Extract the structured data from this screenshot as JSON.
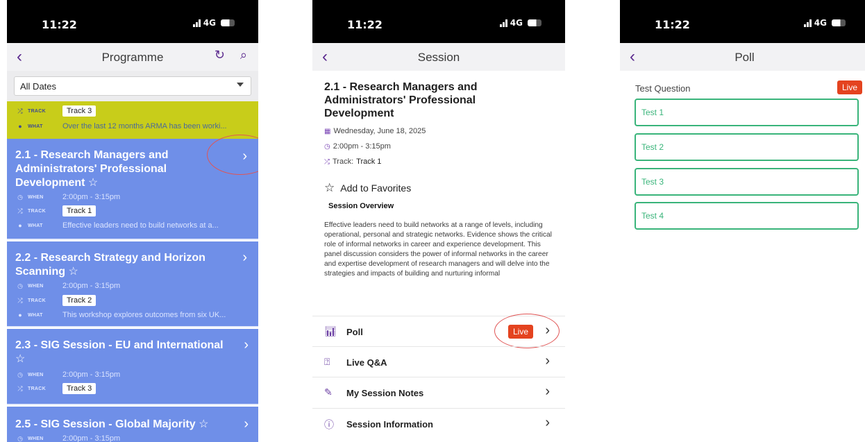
{
  "status": {
    "time": "11:22",
    "network": "4G"
  },
  "screen1": {
    "title": "Programme",
    "filter": "All Dates",
    "labels": {
      "track": "TRACK",
      "what": "WHAT",
      "when": "WHEN"
    },
    "top_card": {
      "track": "Track 3",
      "what": "Over the last 12 months ARMA has been worki..."
    },
    "sessions": [
      {
        "title": "2.1 - Research Managers and Administrators' Professional Development",
        "when": "2:00pm - 3:15pm",
        "track": "Track 1",
        "what": "Effective leaders need to build networks at a..."
      },
      {
        "title": "2.2 - Research Strategy and Horizon Scanning",
        "when": "2:00pm - 3:15pm",
        "track": "Track 2",
        "what": "This workshop explores outcomes from six UK..."
      },
      {
        "title": "2.3 - SIG Session - EU and International",
        "when": "2:00pm - 3:15pm",
        "track": "Track 3"
      },
      {
        "title": "2.5 - SIG Session - Global Majority",
        "when": "2:00pm - 3:15pm"
      }
    ]
  },
  "screen2": {
    "title": "Session",
    "session_title": "2.1 - Research Managers and Administrators' Professional Development",
    "date": "Wednesday, June 18, 2025",
    "time": "2:00pm - 3:15pm",
    "track_label": "Track:",
    "track": "Track 1",
    "favorites": "Add to Favorites",
    "overview_heading": "Session Overview",
    "overview_text": "Effective leaders need to build networks at a range of levels, including operational, personal and strategic networks. Evidence shows the critical role of informal networks in career and experience development. This panel discussion considers the power of informal networks in the career and expertise development of research managers and will delve into the strategies and impacts of building and nurturing informal",
    "menu": [
      {
        "label": "Poll",
        "badge": "Live"
      },
      {
        "label": "Live Q&A"
      },
      {
        "label": "My Session Notes"
      },
      {
        "label": "Session Information"
      }
    ]
  },
  "screen3": {
    "title": "Poll",
    "question": "Test Question",
    "badge": "Live",
    "options": [
      "Test 1",
      "Test 2",
      "Test 3",
      "Test 4"
    ]
  },
  "colors": {
    "accent": "#5b2a8e",
    "session_card": "#6f8fe8",
    "track3_card": "#c8cd1a",
    "live": "#e4431f",
    "poll_option": "#39b47a"
  }
}
